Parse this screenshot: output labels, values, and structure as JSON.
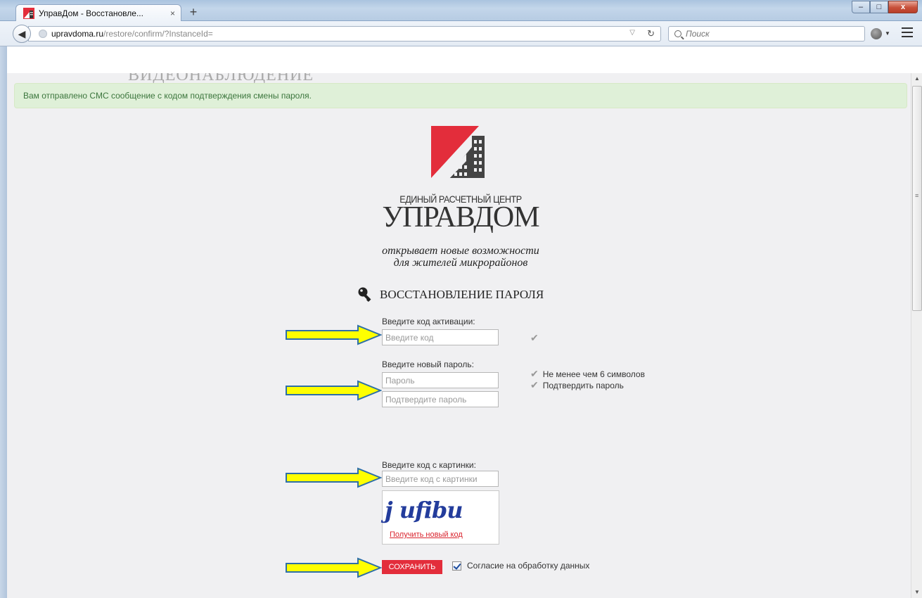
{
  "browser": {
    "tab_title": "УправДом - Восстановле...",
    "tab_close": "×",
    "new_tab": "+",
    "url_host": "upravdoma.ru",
    "url_path": "/restore/confirm/?InstanceId=",
    "search_placeholder": "Поиск",
    "window_minimize": "–",
    "window_maximize": "□",
    "window_close": "x"
  },
  "page": {
    "background_partial_text": "ВИДЕОНАБЛЮДЕНИЕ",
    "alert_text": "Вам отправлено СМС сообщение с кодом подтверждения смены пароля.",
    "brand_top": "ЕДИНЫЙ РАСЧЕТНЫЙ ЦЕНТР",
    "brand_name": "УПРАВДОМ",
    "tagline_line1": "открывает новые возможности",
    "tagline_line2": "для жителей микрорайонов",
    "section_title": "ВОССТАНОВЛЕНИЕ ПАРОЛЯ"
  },
  "form": {
    "activation_label": "Введите код активации:",
    "activation_placeholder": "Введите код",
    "new_password_label": "Введите новый пароль:",
    "password_placeholder": "Пароль",
    "confirm_placeholder": "Подтвердите пароль",
    "hint_min_length": "Не менее чем 6 символов",
    "hint_confirm": "Подтвердить пароль",
    "captcha_label": "Введите код с картинки:",
    "captcha_placeholder": "Введите код с картинки",
    "captcha_text": "j ufibu",
    "captcha_refresh": "Получить новый код",
    "save_button": "СОХРАНИТЬ",
    "consent_label": "Согласие на обработку данных",
    "consent_checked": true
  },
  "colors": {
    "accent_red": "#e32d3b",
    "alert_green_bg": "#dff0d8",
    "alert_green_text": "#3c763d",
    "arrow_yellow": "#ffff00",
    "arrow_outline": "#2e6fa7"
  }
}
